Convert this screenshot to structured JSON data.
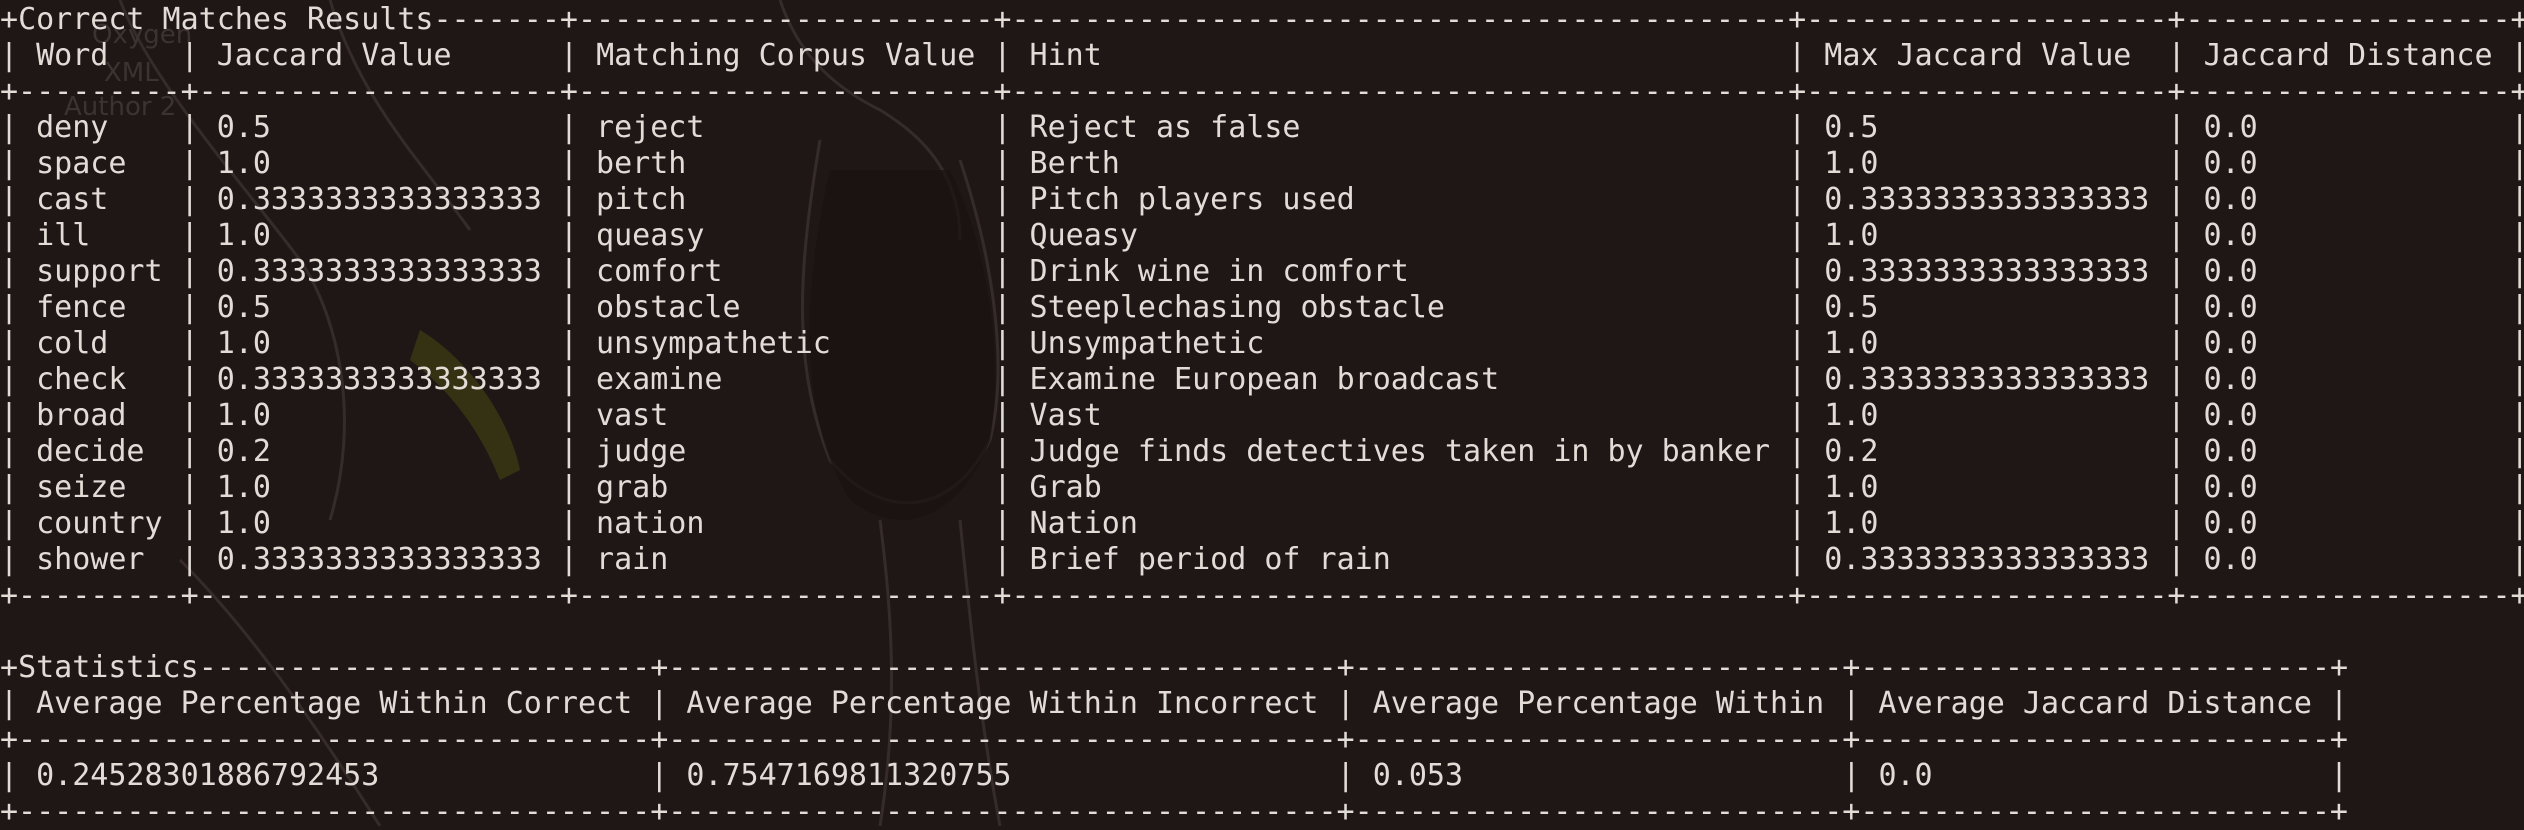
{
  "background": {
    "labels": [
      "Oxygen",
      "XML",
      "Author 2"
    ]
  },
  "correct": {
    "title": "Correct Matches Results",
    "headers": [
      "Word",
      "Jaccard Value",
      "Matching Corpus Value",
      "Hint",
      "Max Jaccard Value",
      "Jaccard Distance"
    ],
    "rows": [
      [
        "deny",
        "0.5",
        "reject",
        "Reject as false",
        "0.5",
        "0.0"
      ],
      [
        "space",
        "1.0",
        "berth",
        "Berth",
        "1.0",
        "0.0"
      ],
      [
        "cast",
        "0.3333333333333333",
        "pitch",
        "Pitch players used",
        "0.3333333333333333",
        "0.0"
      ],
      [
        "ill",
        "1.0",
        "queasy",
        "Queasy",
        "1.0",
        "0.0"
      ],
      [
        "support",
        "0.3333333333333333",
        "comfort",
        "Drink wine in comfort",
        "0.3333333333333333",
        "0.0"
      ],
      [
        "fence",
        "0.5",
        "obstacle",
        "Steeplechasing obstacle",
        "0.5",
        "0.0"
      ],
      [
        "cold",
        "1.0",
        "unsympathetic",
        "Unsympathetic",
        "1.0",
        "0.0"
      ],
      [
        "check",
        "0.3333333333333333",
        "examine",
        "Examine European broadcast",
        "0.3333333333333333",
        "0.0"
      ],
      [
        "broad",
        "1.0",
        "vast",
        "Vast",
        "1.0",
        "0.0"
      ],
      [
        "decide",
        "0.2",
        "judge",
        "Judge finds detectives taken in by banker",
        "0.2",
        "0.0"
      ],
      [
        "seize",
        "1.0",
        "grab",
        "Grab",
        "1.0",
        "0.0"
      ],
      [
        "country",
        "1.0",
        "nation",
        "Nation",
        "1.0",
        "0.0"
      ],
      [
        "shower",
        "0.3333333333333333",
        "rain",
        "Brief period of rain",
        "0.3333333333333333",
        "0.0"
      ]
    ]
  },
  "statistics": {
    "title": "Statistics",
    "headers": [
      "Average Percentage Within Correct",
      "Average Percentage Within Incorrect",
      "Average Percentage Within",
      "Average Jaccard Distance"
    ],
    "rows": [
      [
        "0.24528301886792453",
        "0.7547169811320755",
        "0.053",
        "0.0"
      ]
    ]
  }
}
